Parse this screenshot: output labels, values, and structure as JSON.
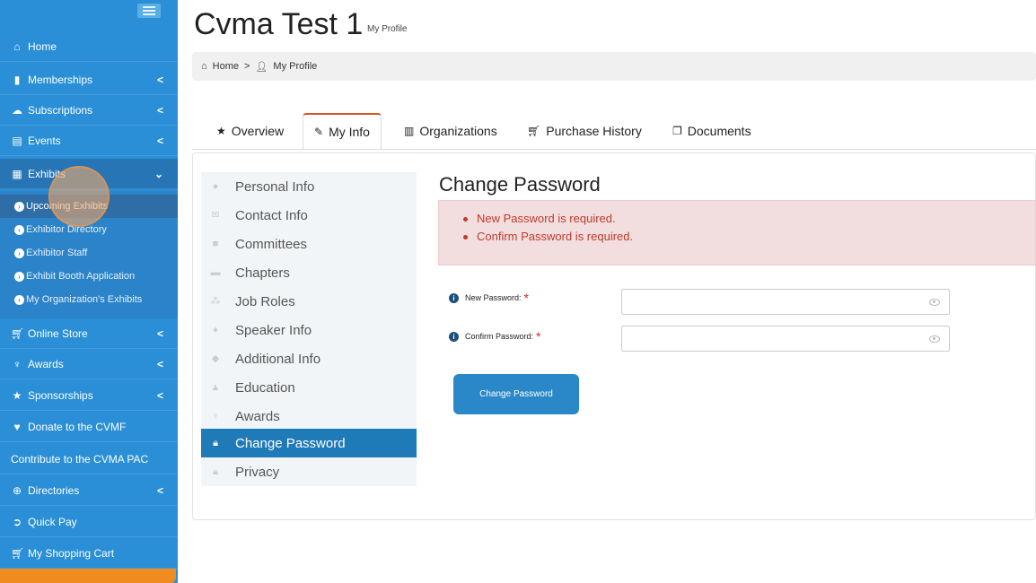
{
  "header": {
    "title": "Cvma Test 1",
    "subtitle": "My Profile"
  },
  "breadcrumb": {
    "home": "Home",
    "separator": ">",
    "current": "My Profile"
  },
  "sidebar": {
    "items": [
      {
        "label": "Home",
        "icon": "home-icon"
      },
      {
        "label": "Memberships",
        "icon": "bookmark-icon",
        "chevron": "<"
      },
      {
        "label": "Subscriptions",
        "icon": "cloud-icon",
        "chevron": "<"
      },
      {
        "label": "Events",
        "icon": "calendar-icon",
        "chevron": "<"
      },
      {
        "label": "Exhibits",
        "icon": "grid-icon",
        "chevron": "v"
      },
      {
        "label": "Online Store",
        "icon": "cart-icon",
        "chevron": "<"
      },
      {
        "label": "Awards",
        "icon": "trophy-icon",
        "chevron": "<"
      },
      {
        "label": "Sponsorships",
        "icon": "star-icon",
        "chevron": "<"
      },
      {
        "label": "Donate to the CVMF",
        "icon": "heart-icon"
      },
      {
        "label": "Contribute to the CVMA PAC"
      },
      {
        "label": "Directories",
        "icon": "plus-circle-icon",
        "chevron": "<"
      },
      {
        "label": "Quick Pay",
        "icon": "arrow-circle-icon"
      },
      {
        "label": "My Shopping Cart",
        "icon": "cart-icon"
      }
    ],
    "exhibits_sub": [
      {
        "label": "Upcoming Exhibits"
      },
      {
        "label": "Exhibitor Directory"
      },
      {
        "label": "Exhibitor Staff"
      },
      {
        "label": "Exhibit Booth Application"
      },
      {
        "label": "My Organization's Exhibits"
      }
    ]
  },
  "tabs": [
    {
      "label": "Overview",
      "icon": "star-icon"
    },
    {
      "label": "My Info",
      "icon": "edit-icon",
      "active": true
    },
    {
      "label": "Organizations",
      "icon": "building-icon"
    },
    {
      "label": "Purchase History",
      "icon": "cart-icon"
    },
    {
      "label": "Documents",
      "icon": "documents-icon"
    }
  ],
  "profile_nav": [
    {
      "label": "Personal Info",
      "icon": "user-icon"
    },
    {
      "label": "Contact Info",
      "icon": "envelope-icon"
    },
    {
      "label": "Committees",
      "icon": "briefcase-icon"
    },
    {
      "label": "Chapters",
      "icon": "folder-icon"
    },
    {
      "label": "Job Roles",
      "icon": "sitemap-icon"
    },
    {
      "label": "Speaker Info",
      "icon": "microphone-icon"
    },
    {
      "label": "Additional Info",
      "icon": "tags-icon"
    },
    {
      "label": "Education",
      "icon": "graduation-cap-icon"
    },
    {
      "label": "Awards",
      "icon": "trophy-icon"
    },
    {
      "label": "Change Password",
      "icon": "lock-icon",
      "active": true
    },
    {
      "label": "Privacy",
      "icon": "lock-icon"
    }
  ],
  "form": {
    "title": "Change Password",
    "errors": [
      "New Password is required.",
      "Confirm Password is required."
    ],
    "new_password_label": "New Password:",
    "confirm_password_label": "Confirm Password:",
    "required_marker": "*",
    "new_password_value": "",
    "confirm_password_value": "",
    "submit_label": "Change Password"
  },
  "colors": {
    "sidebar_bg": "#2a8fd6",
    "active_nav": "#1f7ab8",
    "tab_accent": "#d7562d",
    "alert_bg": "#f2dede",
    "alert_text": "#c0392b",
    "button_bg": "#2a88c8"
  }
}
